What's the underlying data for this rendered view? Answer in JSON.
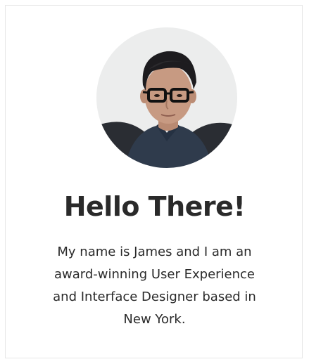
{
  "profile": {
    "avatar": {
      "icon": "profile-photo",
      "description_colors": {
        "background": "#e9e9ea",
        "shirt": "#2f3b4c",
        "skin": "#c79a82",
        "hair": "#1d1c1f"
      }
    },
    "heading": "Hello There!",
    "bio_lines": [
      "My name is James and I am an",
      "award-winning User Experience",
      "and Interface Designer based in",
      "New York."
    ]
  },
  "colors": {
    "text": "#2a2a2a",
    "card_border": "#e6e6e6",
    "page_background": "#ffffff"
  }
}
